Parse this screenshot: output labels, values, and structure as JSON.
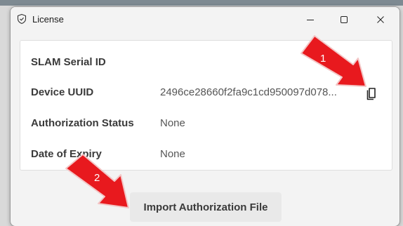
{
  "window": {
    "title": "License",
    "minimize_symbol": "–",
    "maximize_symbol": "☐",
    "close_symbol": "✕"
  },
  "license": {
    "rows": [
      {
        "label": "SLAM Serial ID",
        "value": ""
      },
      {
        "label": "Device UUID",
        "value": "2496ce28660f2fa9c1cd950097d078..."
      },
      {
        "label": "Authorization Status",
        "value": "None"
      },
      {
        "label": "Date of Expiry",
        "value": "None"
      }
    ]
  },
  "import_button": {
    "label": "Import Authorization File"
  },
  "annotations": {
    "arrow1_number": "1",
    "arrow2_number": "2",
    "arrow_color": "#e8191e"
  },
  "icons": {
    "title": "shield-check-icon",
    "copy": "copy-icon"
  }
}
